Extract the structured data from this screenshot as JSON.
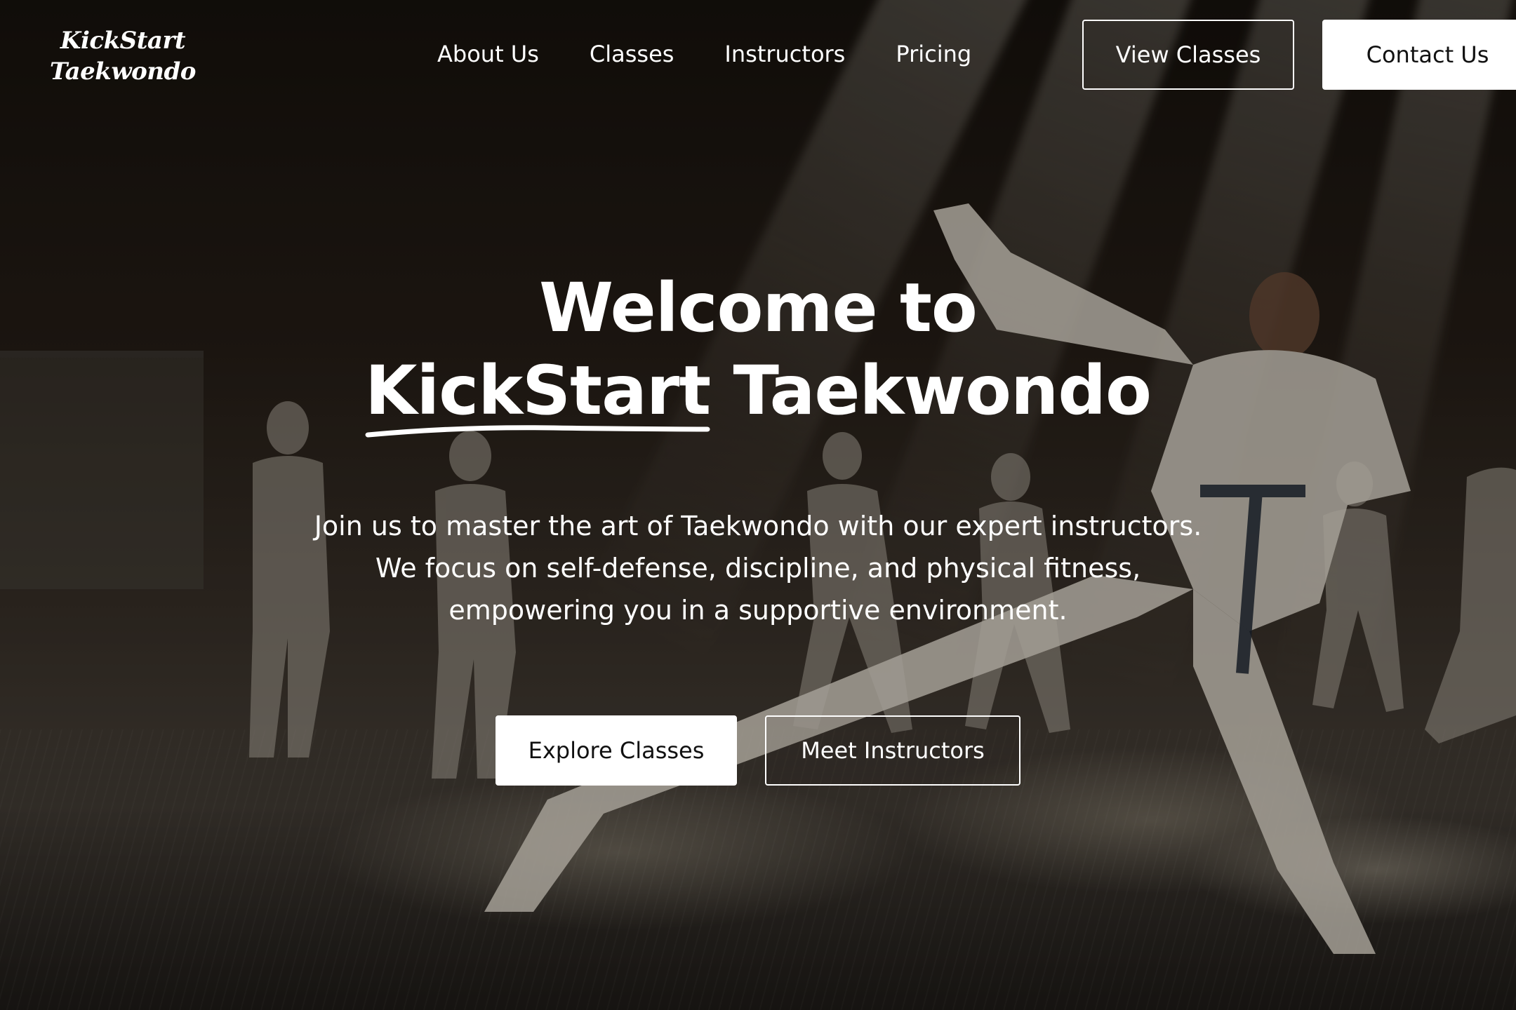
{
  "brand": {
    "logo_line1": "KickStart",
    "logo_line2": "Taekwondo"
  },
  "nav": {
    "links": [
      {
        "label": "About Us"
      },
      {
        "label": "Classes"
      },
      {
        "label": "Instructors"
      },
      {
        "label": "Pricing"
      }
    ],
    "view_classes_label": "View Classes",
    "contact_label": "Contact Us"
  },
  "hero": {
    "title_line1": "Welcome to",
    "title_highlight": "KickStart",
    "title_rest": "Taekwondo",
    "subtitle": "Join us to master the art of Taekwondo with our expert instructors. We focus on self-defense, discipline, and physical fitness, empowering you in a supportive environment.",
    "primary_cta": "Explore Classes",
    "secondary_cta": "Meet Instructors"
  },
  "colors": {
    "text": "#ffffff",
    "button_solid_bg": "#ffffff",
    "button_solid_text": "#111111",
    "overlay": "#000000"
  }
}
